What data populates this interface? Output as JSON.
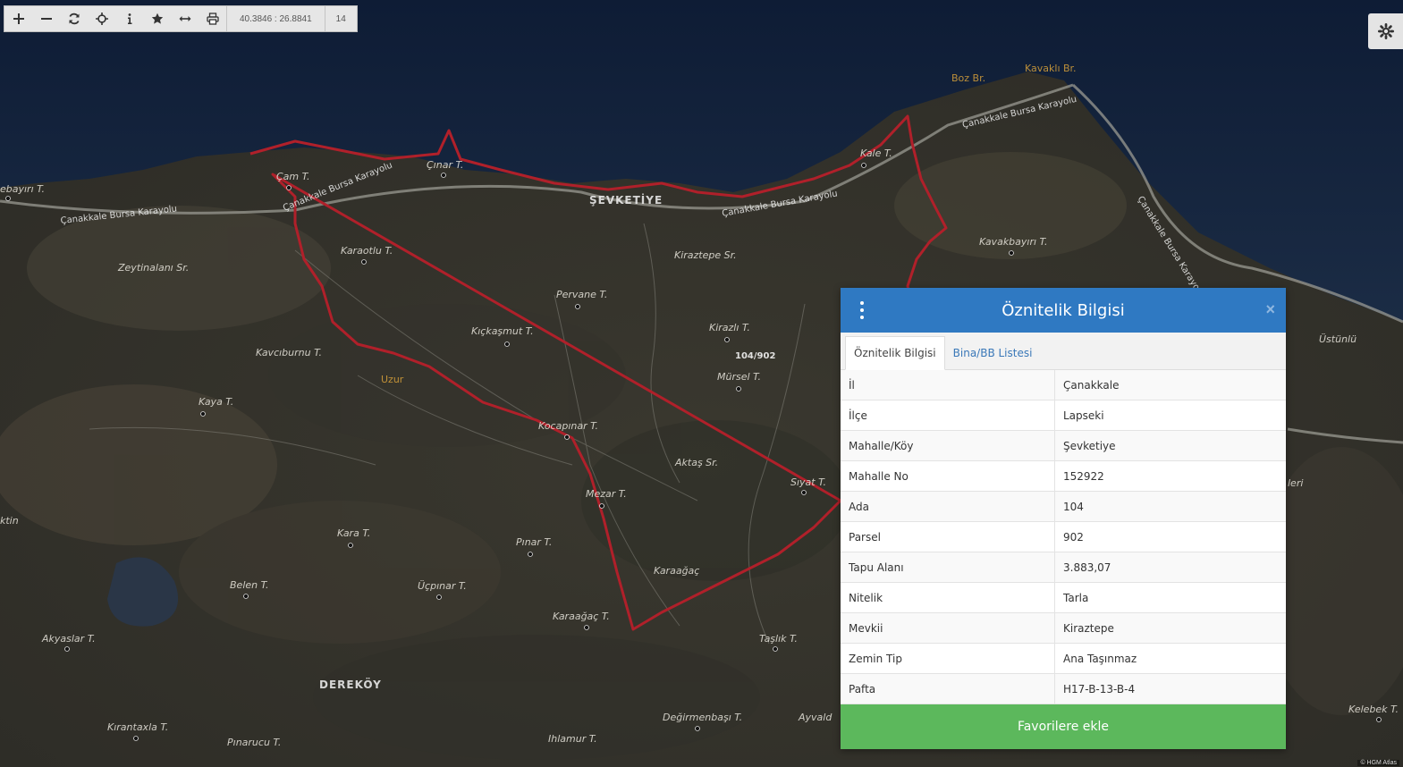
{
  "toolbar": {
    "coords": "40.3846 : 26.8841",
    "zoom": "14",
    "buttons": [
      "zoom-in-icon",
      "zoom-out-icon",
      "refresh-icon",
      "locate-icon",
      "info-icon",
      "star-icon",
      "measure-icon",
      "print-icon"
    ]
  },
  "map": {
    "labels": {
      "boz_br": "Boz Br.",
      "kavakli_br": "Kavaklı Br.",
      "cam_t": "Çam T.",
      "cinar_t": "Çınar T.",
      "sevketiye": "ŞEVKETİYE",
      "kale_t": "Kale T.",
      "road1": "Çanakkale Bursa Karayolu",
      "road2": "Çanakkale Bursa Karayolu",
      "road3": "Çanakkale Bursa Karayolu",
      "road4": "Çanakkale Bursa Karayolu",
      "road5": "Çanakkale Bursa Karayolu",
      "pinarbayiri": "ebayırı T.",
      "kavakbayiri": "Kavakbayırı T.",
      "zeytinalani": "Zeytinalanı Sr.",
      "karaotlu": "Karaotlu T.",
      "kiraztepe_sr": "Kiraztepe Sr.",
      "pervane": "Pervane T.",
      "kirazli": "Kirazlı T.",
      "kickasmut": "Kıçkaşmut T.",
      "parcel": "104/902",
      "mursel": "Mürsel T.",
      "kavciburnu": "Kavcıburnu T.",
      "uzur": "Uzur",
      "kaya": "Kaya T.",
      "kocapinar": "Kocapınar T.",
      "aktas": "Aktaş Sr.",
      "siyat": "Sıyat T.",
      "mezar": "Mezar T.",
      "kara": "Kara T.",
      "pinar": "Pınar T.",
      "karaagac": "Karaağaç",
      "belen": "Belen T.",
      "ucpinar": "Üçpınar T.",
      "akyaslar": "Akyaslar T.",
      "karaagac_t": "Karaağaç T.",
      "taslik": "Taşlık T.",
      "derekoy": "DEREKÖY",
      "kirantaxla": "Kırantaxla T.",
      "degirmenbasi": "Değirmenbaşı T.",
      "ayvaldere": "Ayvald",
      "pinarucu": "Pınarucu T.",
      "ihlamur": "Ihlamur T.",
      "ustunlu": "Üstünlü",
      "kelebek": "Kelebek T.",
      "lerl": "leri",
      "kutin": "ktin"
    },
    "attribution": "© HGM Atlas"
  },
  "panel": {
    "title": "Öznitelik Bilgisi",
    "close": "×",
    "tabs": [
      "Öznitelik Bilgisi",
      "Bina/BB Listesi"
    ],
    "rows": [
      {
        "key": "İl",
        "value": "Çanakkale"
      },
      {
        "key": "İlçe",
        "value": "Lapseki"
      },
      {
        "key": "Mahalle/Köy",
        "value": "Şevketiye"
      },
      {
        "key": "Mahalle No",
        "value": "152922"
      },
      {
        "key": "Ada",
        "value": "104"
      },
      {
        "key": "Parsel",
        "value": "902"
      },
      {
        "key": "Tapu Alanı",
        "value": "3.883,07"
      },
      {
        "key": "Nitelik",
        "value": "Tarla"
      },
      {
        "key": "Mevkii",
        "value": "Kiraztepe"
      },
      {
        "key": "Zemin Tip",
        "value": "Ana Taşınmaz"
      },
      {
        "key": "Pafta",
        "value": "H17-B-13-B-4"
      }
    ],
    "favorite_label": "Favorilere ekle"
  },
  "colors": {
    "header": "#2f79c2",
    "favorite": "#5cb85c",
    "boundary": "#b0202a"
  }
}
